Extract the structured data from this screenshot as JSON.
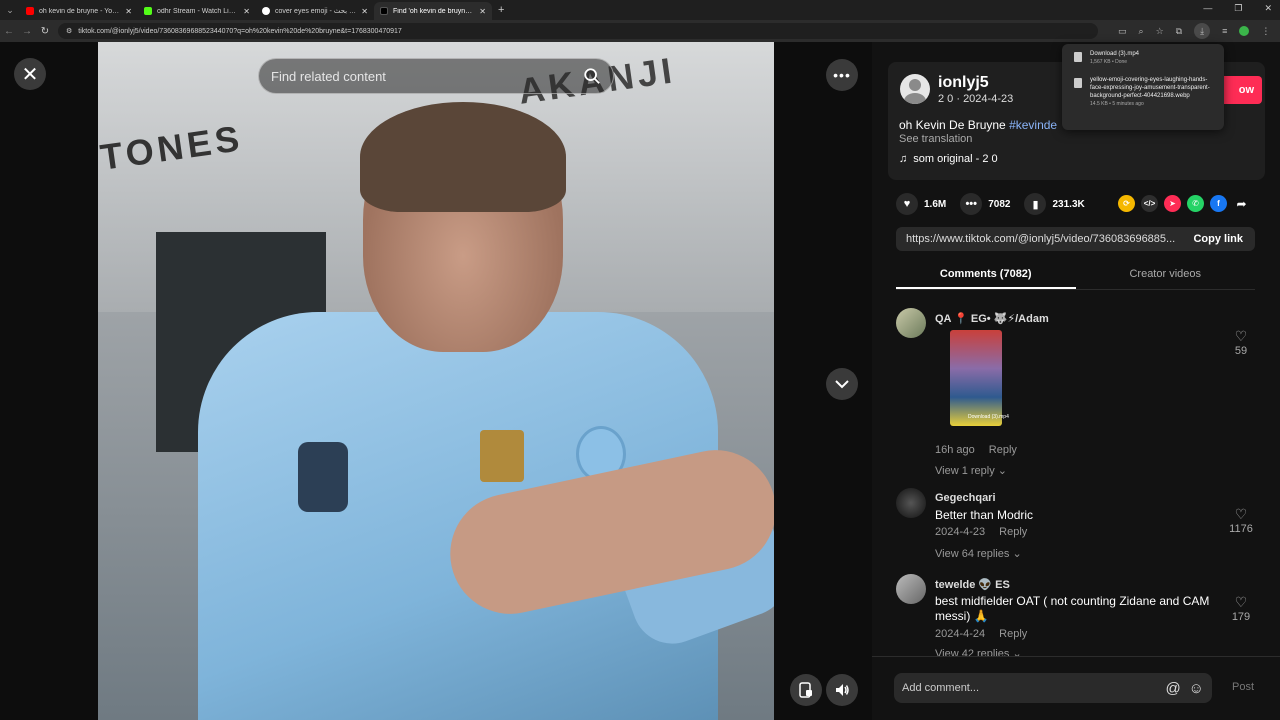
{
  "browser": {
    "tabs": [
      {
        "label": "oh kevin de bruyne - YouTube",
        "color": "#ff0000",
        "active": false
      },
      {
        "label": "odhr Stream - Watch Live on Ki",
        "color": "#53fc18",
        "active": false
      },
      {
        "label": "cover eyes emoji - بحث Google",
        "color": "#ffffff",
        "active": false
      },
      {
        "label": "Find 'oh kevin de bruyne' o",
        "color": "#000000",
        "active": true
      }
    ],
    "url": "tiktok.com/@ionlyj5/video/7360836968852344070?q=oh%20kevin%20de%20bruyne&t=1768300470917"
  },
  "video": {
    "search_placeholder": "Find related content",
    "sign_left": "TONES",
    "sign_right": "AKANJI"
  },
  "author": {
    "username": "ionlyj5",
    "meta": "2 0 · 2024-4-23",
    "follow_label": "ow",
    "description": "oh Kevin De Bruyne ",
    "hashtag": "#kevinde",
    "see_translation": "See translation",
    "sound": "som original - 2 0"
  },
  "stats": {
    "likes": "1.6M",
    "comments": "7082",
    "saves": "231.3K"
  },
  "link": {
    "url": "https://www.tiktok.com/@ionlyj5/video/736083696885...",
    "copy_label": "Copy link"
  },
  "tabs": {
    "comments": "Comments (7082)",
    "creator": "Creator videos"
  },
  "comments": [
    {
      "name": "QA 📍 EG• 🐺⚡/Adam",
      "text": "",
      "date": "16h ago",
      "reply": "Reply",
      "view": "View 1 reply ⌄",
      "likes": "59",
      "thumb_caption": "Download (3).mp4"
    },
    {
      "name": "Gegechqari",
      "text": "Better than Modric",
      "date": "2024-4-23",
      "reply": "Reply",
      "view": "View 64 replies ⌄",
      "likes": "1176"
    },
    {
      "name": "tewelde 👽 ES",
      "text": "best midfielder OAT ( not counting Zidane and CAM messi) 🙏",
      "date": "2024-4-24",
      "reply": "Reply",
      "view": "View 42 replies ⌄",
      "likes": "179"
    }
  ],
  "compose": {
    "placeholder": "Add comment...",
    "post_label": "Post"
  },
  "downloads": [
    {
      "name": "Download (3).mp4",
      "sub": "1,567 KB • Done"
    },
    {
      "name": "yellow-emoji-covering-eyes-laughing-hands-face-expressing-joy-amusement-transparent-background-perfect-404421698.webp",
      "sub": "14.5 KB • 5 minutes ago"
    }
  ]
}
